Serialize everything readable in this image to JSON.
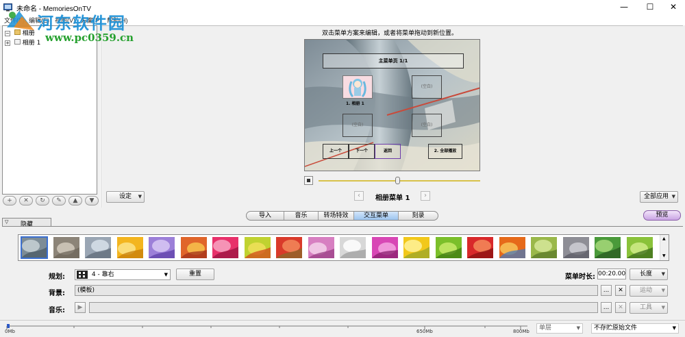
{
  "window": {
    "title": "未命名 - MemoriesOnTV",
    "minimize": "—",
    "maximize": "☐",
    "close": "✕"
  },
  "menubar": {
    "items": [
      "文件(F)",
      "编辑(E)",
      "视图(V)",
      "方案(P)",
      "帮助(H)"
    ]
  },
  "watermark": {
    "title": "河东软件园",
    "url": "www.pc0359.cn"
  },
  "tree": {
    "root": "相册",
    "child": "相册 1"
  },
  "left_buttons": [
    "+",
    "✕",
    "↻",
    "✎",
    "▲",
    "▼"
  ],
  "main": {
    "instruction": "双击菜单方案来编辑，或者将菜单拖动到新位置。",
    "settings_label": "设定",
    "menu_name": "相册菜单 1",
    "apply_all_label": "全部应用"
  },
  "canvas_menu": {
    "title": "主菜单页 1/1",
    "item1_caption": "1. 相册 1",
    "empty1": "(空白)",
    "empty2": "(空白)",
    "empty3": "(空白)",
    "btn_prev": "上一个",
    "btn_next": "下一个",
    "btn_back": "返回",
    "btn_playall": "2. 全部播放"
  },
  "tabs": {
    "items": [
      "导入",
      "音乐",
      "转场特效",
      "交互菜单",
      "刻录"
    ],
    "active": "交互菜单",
    "preview_label": "预览"
  },
  "hide_tab_label": "隐藏",
  "layout_row": {
    "label": "规划:",
    "value": "4 - 靠右",
    "reset_label": "重置",
    "duration_label": "菜单时长:",
    "duration_value": "00:20.00",
    "length_label": "长度"
  },
  "background_row": {
    "label": "背景:",
    "value": "(模板)",
    "browse": "...",
    "clear": "✕",
    "motion_label": "运动"
  },
  "music_row": {
    "label": "音乐:",
    "browse": "...",
    "clear": "✕",
    "tools_label": "工具"
  },
  "statusbar": {
    "ticks": [
      "0Mb",
      "650Mb",
      "800Mb"
    ],
    "layer_select": "单层",
    "file_select": "不存贮原始文件"
  },
  "colors": {
    "accent_tab": "#9cc4ee",
    "preview_purple": "#c9a5e3",
    "watermark_blue": "#1a8fd6",
    "watermark_green": "#25a02e"
  }
}
